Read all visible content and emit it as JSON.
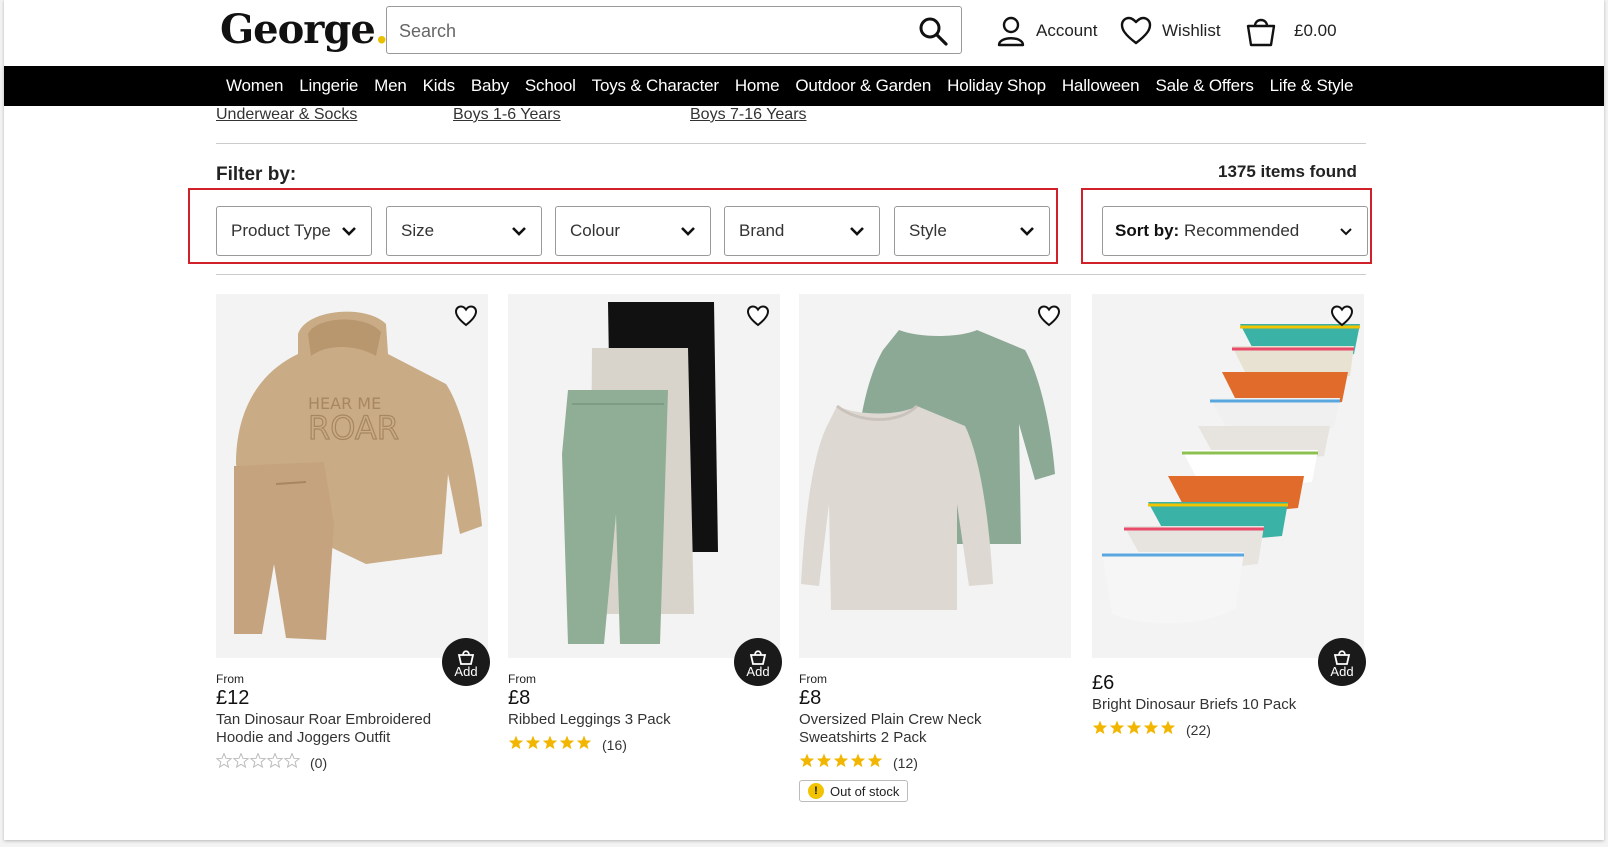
{
  "header": {
    "logo": "George",
    "logo_dot": ".",
    "search_placeholder": "Search",
    "account_label": "Account",
    "wishlist_label": "Wishlist",
    "basket_total": "£0.00"
  },
  "nav": {
    "items": [
      "Women",
      "Lingerie",
      "Men",
      "Kids",
      "Baby",
      "School",
      "Toys & Character",
      "Home",
      "Outdoor & Garden",
      "Holiday Shop",
      "Halloween",
      "Sale & Offers",
      "Life & Style"
    ]
  },
  "sublinks": [
    "Underwear & Socks",
    "Boys 1-6 Years",
    "Boys 7-16 Years"
  ],
  "filters": {
    "label": "Filter by:",
    "items_found": "1375 items found",
    "dropdowns": [
      "Product Type",
      "Size",
      "Colour",
      "Brand",
      "Style"
    ],
    "sort_label": "Sort by:",
    "sort_value": "Recommended"
  },
  "products": [
    {
      "from": "From",
      "price": "£12",
      "title": "Tan Dinosaur Roar Embroidered Hoodie and Joggers Outfit",
      "rating_stars": 0,
      "rating_count": "(0)",
      "add_label": "Add"
    },
    {
      "from": "From",
      "price": "£8",
      "title": "Ribbed Leggings 3 Pack",
      "rating_stars": 5,
      "rating_count": "(16)",
      "add_label": "Add"
    },
    {
      "from": "From",
      "price": "£8",
      "title": "Oversized Plain Crew Neck Sweatshirts 2 Pack",
      "rating_stars": 5,
      "rating_count": "(12)",
      "stock_status": "Out of stock"
    },
    {
      "from": "",
      "price": "£6",
      "title": "Bright Dinosaur Briefs 10 Pack",
      "rating_stars": 5,
      "rating_count": "(22)",
      "add_label": "Add"
    }
  ],
  "colors": {
    "nav_bg": "#000000",
    "highlight_border": "#d0202a",
    "star_filled": "#f2b600",
    "star_empty": "#bbbbbb",
    "oos_badge": "#f2c300"
  }
}
